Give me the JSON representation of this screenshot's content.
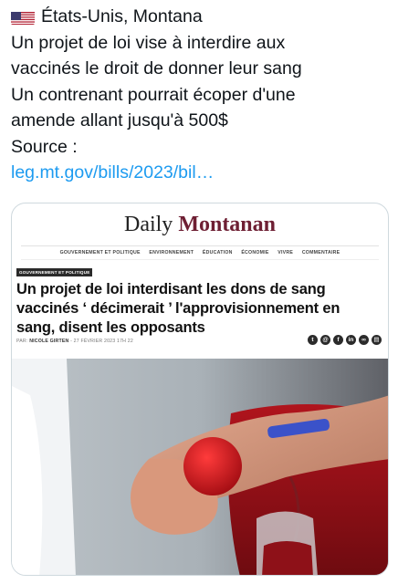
{
  "tweet": {
    "flag_icon": "us-flag-icon",
    "location": "États-Unis, Montana",
    "line1": "Un projet de loi vise à interdire aux",
    "line2": "vaccinés le droit de donner leur sang",
    "line3": "Un contrenant pourrait écoper d'une",
    "line4": "amende allant jusqu'à 500$",
    "source_label": "Source :",
    "link_text": "leg.mt.gov/bills/2023/bil…",
    "link_color": "#1d9bf0"
  },
  "card": {
    "site_word1": "Daily",
    "site_word2": "Montanan",
    "brand_color": "#6e1f33",
    "nav": [
      "GOUVERNEMENT ET POLITIQUE",
      "ENVIRONNEMENT",
      "ÉDUCATION",
      "ÉCONOMIE",
      "VIVRE",
      "COMMENTAIRE"
    ],
    "category": "GOUVERNEMENT ET POLITIQUE",
    "headline": "Un projet de loi interdisant les dons de sang vaccinés ‘ décimerait ’ l'approvisionnement en sang, disent les opposants",
    "byline_prefix": "PAR:",
    "author": "NICOLE GIRTEN",
    "date": "- 27 FÉVRIER 2023 17H 22",
    "share_icons": [
      "twitter-icon",
      "mail-icon",
      "facebook-icon",
      "linkedin-icon",
      "link-icon",
      "print-icon"
    ]
  }
}
